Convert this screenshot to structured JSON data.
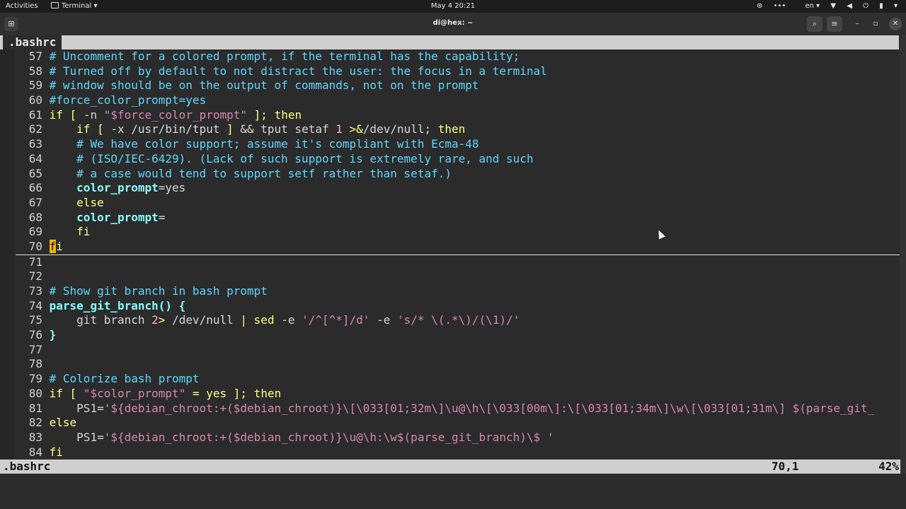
{
  "topbar": {
    "activities": "Activities",
    "app_menu": "Terminal",
    "clock": "May 4  20:21",
    "lang": "en"
  },
  "window": {
    "title": "di@hex: ~",
    "icons": {
      "new_tab": "new-tab-icon",
      "search": "search-icon",
      "menu": "hamburger-menu-icon",
      "minimize": "minimize-icon",
      "maximize": "maximize-icon",
      "close": "close-icon"
    }
  },
  "vim": {
    "tab_name": ".bashrc",
    "status_file": ".bashrc",
    "status_position": "70,1",
    "status_percent": "42%",
    "colors": {
      "comment": "#5fd7ff",
      "keyword": "#ffff87",
      "string": "#d787af",
      "identifier": "#87ffff",
      "cursor": "#f5b400"
    },
    "lines": [
      {
        "n": "57",
        "tokens": [
          [
            "comment",
            "# Uncomment for a colored prompt, if the terminal has the capability;"
          ]
        ]
      },
      {
        "n": "58",
        "tokens": [
          [
            "comment",
            "# Turned off by default to not distract the user: the focus in a terminal"
          ]
        ]
      },
      {
        "n": "59",
        "tokens": [
          [
            "comment",
            "# window should be on the output of commands, not on the prompt"
          ]
        ]
      },
      {
        "n": "60",
        "tokens": [
          [
            "comment",
            "#force_color_prompt=yes"
          ]
        ]
      },
      {
        "n": "61",
        "tokens": [
          [
            "kw",
            "if"
          ],
          [
            "plain",
            " "
          ],
          [
            "op",
            "["
          ],
          [
            "plain",
            " -n "
          ],
          [
            "str",
            "\"$force_color_prompt\""
          ],
          [
            "plain",
            " "
          ],
          [
            "op",
            "];"
          ],
          [
            "plain",
            " "
          ],
          [
            "kw",
            "then"
          ]
        ]
      },
      {
        "n": "62",
        "tokens": [
          [
            "plain",
            "    "
          ],
          [
            "kw",
            "if"
          ],
          [
            "plain",
            " "
          ],
          [
            "op",
            "["
          ],
          [
            "plain",
            " -x /usr/bin/tput "
          ],
          [
            "op",
            "]"
          ],
          [
            "plain",
            " && tput setaf "
          ],
          [
            "num",
            "1"
          ],
          [
            "plain",
            " "
          ],
          [
            "op",
            ">&"
          ],
          [
            "plain",
            "/dev/null; "
          ],
          [
            "kw",
            "then"
          ]
        ]
      },
      {
        "n": "63",
        "tokens": [
          [
            "plain",
            "    "
          ],
          [
            "comment",
            "# We have color support; assume it's compliant with Ecma-48"
          ]
        ]
      },
      {
        "n": "64",
        "tokens": [
          [
            "plain",
            "    "
          ],
          [
            "comment",
            "# (ISO/IEC-6429). (Lack of such support is extremely rare, and such"
          ]
        ]
      },
      {
        "n": "65",
        "tokens": [
          [
            "plain",
            "    "
          ],
          [
            "comment",
            "# a case would tend to support setf rather than setaf.)"
          ]
        ]
      },
      {
        "n": "66",
        "tokens": [
          [
            "plain",
            "    "
          ],
          [
            "id",
            "color_prompt"
          ],
          [
            "plain",
            "=yes"
          ]
        ]
      },
      {
        "n": "67",
        "tokens": [
          [
            "plain",
            "    "
          ],
          [
            "kw",
            "else"
          ]
        ]
      },
      {
        "n": "68",
        "tokens": [
          [
            "plain",
            "    "
          ],
          [
            "id",
            "color_prompt"
          ],
          [
            "plain",
            "="
          ]
        ]
      },
      {
        "n": "69",
        "tokens": [
          [
            "plain",
            "    "
          ],
          [
            "kw",
            "fi"
          ]
        ]
      },
      {
        "n": "70",
        "cursorline": true,
        "tokens": [
          [
            "cursor",
            "f"
          ],
          [
            "kw",
            "i"
          ]
        ]
      },
      {
        "n": "71",
        "tokens": []
      },
      {
        "n": "72",
        "tokens": []
      },
      {
        "n": "73",
        "tokens": [
          [
            "comment",
            "# Show git branch in bash prompt"
          ]
        ]
      },
      {
        "n": "74",
        "tokens": [
          [
            "fn",
            "parse_git_branch() {"
          ]
        ]
      },
      {
        "n": "75",
        "tokens": [
          [
            "plain",
            "    git branch "
          ],
          [
            "num",
            "2"
          ],
          [
            "op",
            ">"
          ],
          [
            "plain",
            " /dev/null "
          ],
          [
            "op",
            "|"
          ],
          [
            "plain",
            " "
          ],
          [
            "kw",
            "sed"
          ],
          [
            "plain",
            " -e "
          ],
          [
            "str",
            "'/^[^*]/d'"
          ],
          [
            "plain",
            " -e "
          ],
          [
            "str",
            "'s/* \\(.*\\)/(\\1)/'"
          ]
        ]
      },
      {
        "n": "76",
        "tokens": [
          [
            "fn",
            "}"
          ]
        ]
      },
      {
        "n": "77",
        "tokens": []
      },
      {
        "n": "78",
        "tokens": []
      },
      {
        "n": "79",
        "tokens": [
          [
            "comment",
            "# Colorize bash prompt"
          ]
        ]
      },
      {
        "n": "80",
        "tokens": [
          [
            "kw",
            "if"
          ],
          [
            "plain",
            " "
          ],
          [
            "op",
            "["
          ],
          [
            "plain",
            " "
          ],
          [
            "str",
            "\"$color_prompt\""
          ],
          [
            "plain",
            " "
          ],
          [
            "op",
            "="
          ],
          [
            "plain",
            " "
          ],
          [
            "kw",
            "yes"
          ],
          [
            "plain",
            " "
          ],
          [
            "op",
            "];"
          ],
          [
            "plain",
            " "
          ],
          [
            "kw",
            "then"
          ]
        ]
      },
      {
        "n": "81",
        "tokens": [
          [
            "plain",
            "    PS1="
          ],
          [
            "str",
            "'${debian_chroot:+($debian_chroot)}\\[\\033[01;32m\\]\\u@\\h\\[\\033[00m\\]:\\[\\033[01;34m\\]\\w\\[\\033[01;31m\\] $(parse_git_"
          ]
        ]
      },
      {
        "n": "82",
        "tokens": [
          [
            "kw",
            "else"
          ]
        ]
      },
      {
        "n": "83",
        "tokens": [
          [
            "plain",
            "    PS1="
          ],
          [
            "str",
            "'${debian_chroot:+($debian_chroot)}\\u@\\h:\\w$(parse_git_branch)\\$ '"
          ]
        ]
      },
      {
        "n": "84",
        "tokens": [
          [
            "kw",
            "fi"
          ]
        ]
      }
    ]
  }
}
